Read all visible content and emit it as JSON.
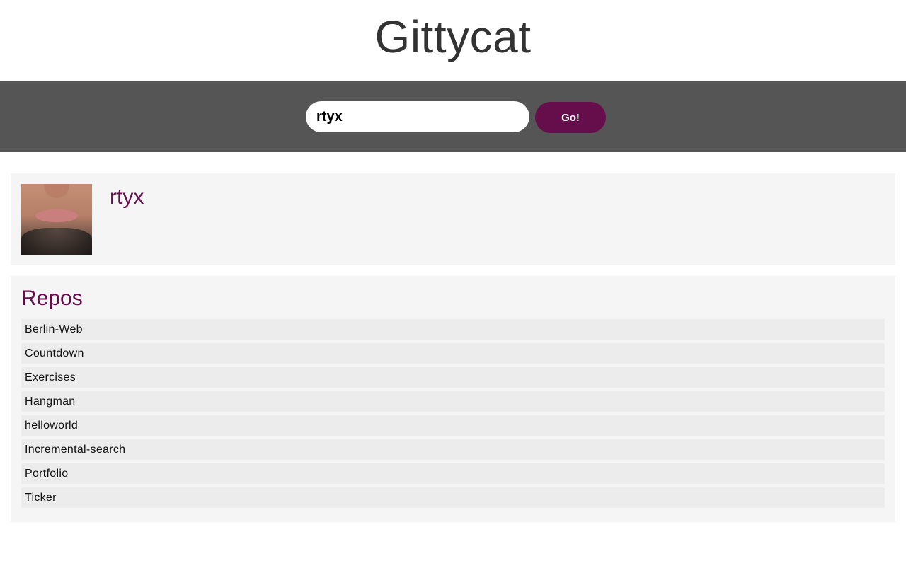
{
  "header": {
    "title": "Gittycat"
  },
  "search": {
    "value": "rtyx",
    "button_label": "Go!"
  },
  "user": {
    "username": "rtyx"
  },
  "repos": {
    "title": "Repos",
    "items": [
      "Berlin-Web",
      "Countdown",
      "Exercises",
      "Hangman",
      "helloworld",
      "Incremental-search",
      "Portfolio",
      "Ticker"
    ]
  },
  "colors": {
    "accent": "#660e4b",
    "search_bar_bg": "#555555",
    "card_bg": "#f5f5f5",
    "repo_item_bg": "#ececec",
    "title_text": "#333333"
  }
}
